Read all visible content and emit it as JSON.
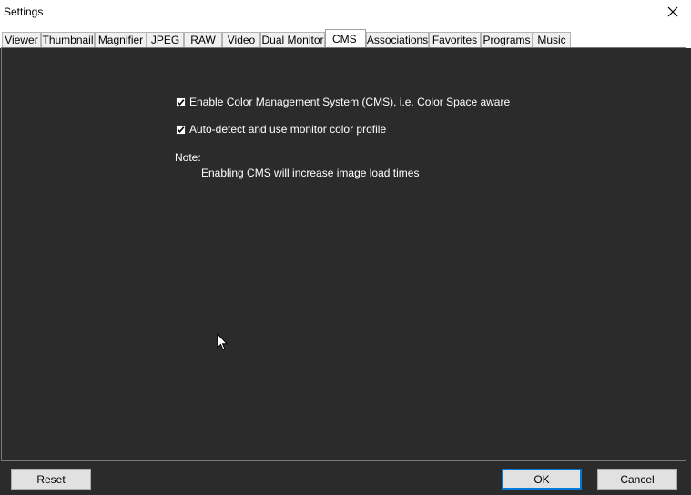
{
  "window": {
    "title": "Settings"
  },
  "tabs": [
    {
      "label": "Viewer",
      "active": false
    },
    {
      "label": "Thumbnail",
      "active": false
    },
    {
      "label": "Magnifier",
      "active": false
    },
    {
      "label": "JPEG",
      "active": false
    },
    {
      "label": "RAW",
      "active": false
    },
    {
      "label": "Video",
      "active": false
    },
    {
      "label": "Dual Monitor",
      "active": false
    },
    {
      "label": "CMS",
      "active": true
    },
    {
      "label": "Associations",
      "active": false
    },
    {
      "label": "Favorites",
      "active": false
    },
    {
      "label": "Programs",
      "active": false
    },
    {
      "label": "Music",
      "active": false
    }
  ],
  "cms": {
    "enable_cms": {
      "label": "Enable Color Management System (CMS), i.e. Color Space aware",
      "checked": true
    },
    "auto_detect": {
      "label": "Auto-detect and use monitor color profile",
      "checked": true
    },
    "note_label": "Note:",
    "note_text": "Enabling CMS will increase image load times"
  },
  "buttons": {
    "reset": "Reset",
    "ok": "OK",
    "cancel": "Cancel"
  },
  "colors": {
    "panel_bg": "#2b2b2b",
    "accent": "#0078d7"
  }
}
